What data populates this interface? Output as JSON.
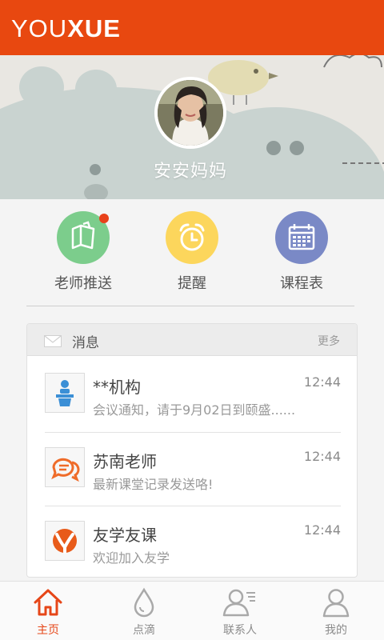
{
  "app": {
    "logo_light": "YOU",
    "logo_bold": "XUE",
    "brand_color": "#e84810"
  },
  "profile": {
    "name": "安安妈妈"
  },
  "quick_actions": [
    {
      "label": "老师推送",
      "icon": "clipboard-icon",
      "color": "#7ccd8c",
      "has_badge": true
    },
    {
      "label": "提醒",
      "icon": "alarm-clock-icon",
      "color": "#fcd65c",
      "has_badge": false
    },
    {
      "label": "课程表",
      "icon": "calendar-icon",
      "color": "#7a89c6",
      "has_badge": false
    }
  ],
  "messages": {
    "title": "消息",
    "more": "更多",
    "items": [
      {
        "name": "**机构",
        "time": "12:44",
        "preview": "会议通知，请于9月02日到颐盛......",
        "icon": "speaker-podium-icon"
      },
      {
        "name": "苏南老师",
        "time": "12:44",
        "preview": "最新课堂记录发送咯!",
        "icon": "chat-bubbles-icon"
      },
      {
        "name": "友学友课",
        "time": "12:44",
        "preview": "欢迎加入友学",
        "icon": "youxue-logo-icon"
      }
    ]
  },
  "bottom_nav": [
    {
      "label": "主页",
      "icon": "home-icon",
      "active": true
    },
    {
      "label": "点滴",
      "icon": "droplet-icon",
      "active": false
    },
    {
      "label": "联系人",
      "icon": "contacts-icon",
      "active": false
    },
    {
      "label": "我的",
      "icon": "person-icon",
      "active": false
    }
  ]
}
